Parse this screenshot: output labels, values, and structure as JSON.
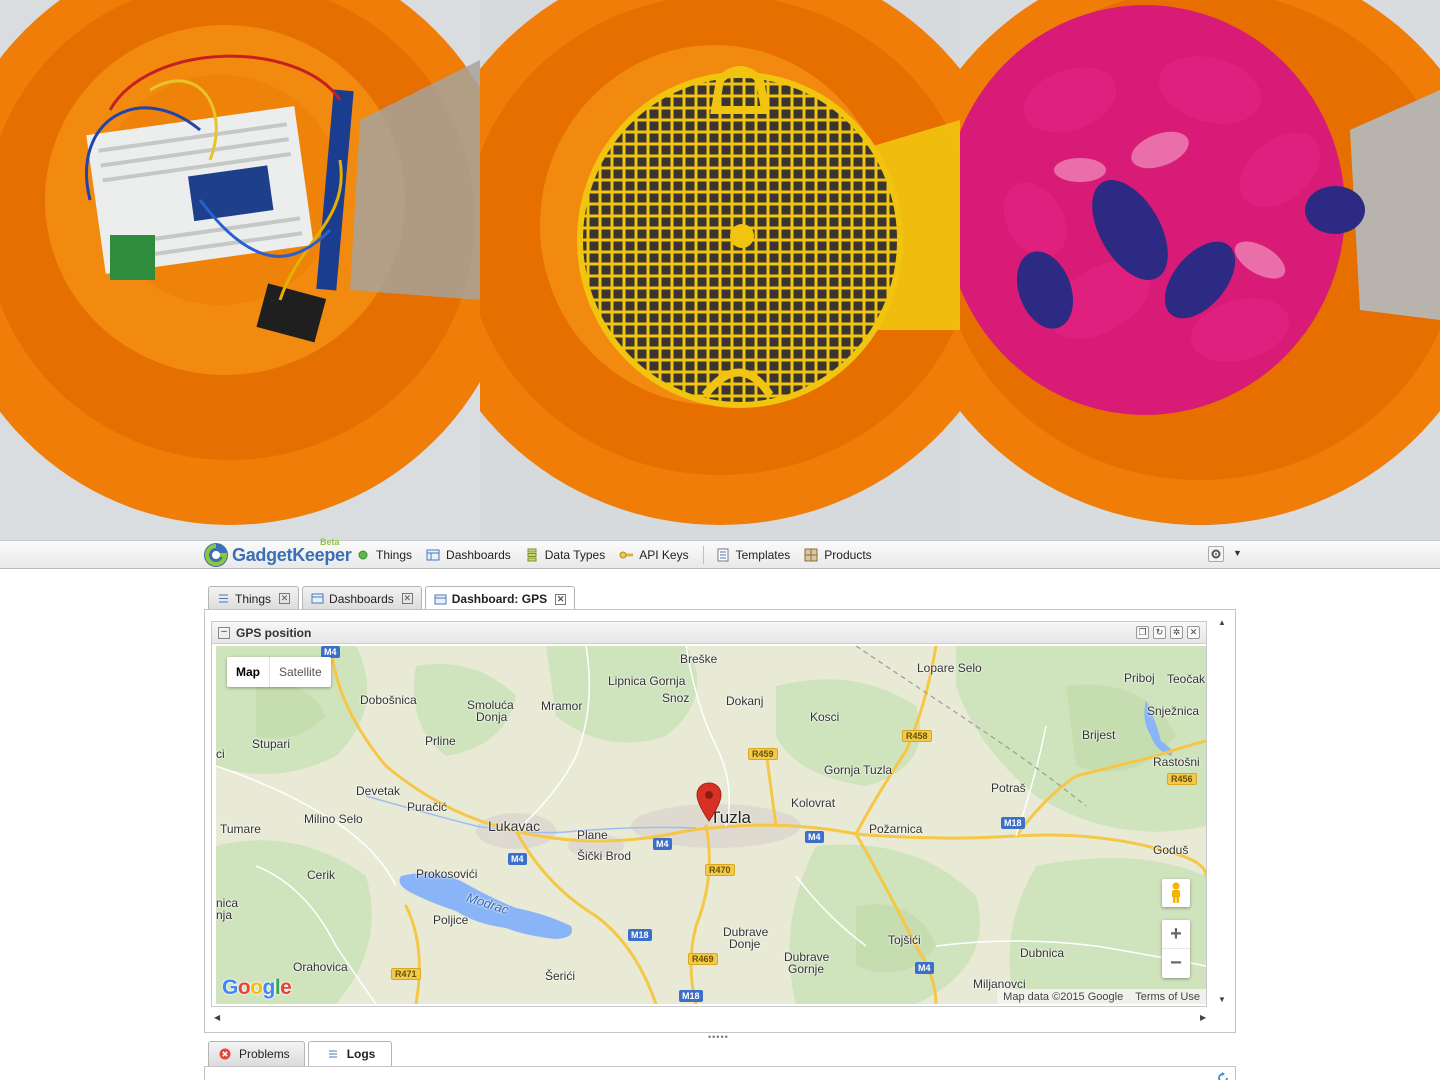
{
  "app": {
    "logo_text": "GadgetKeeper",
    "logo_badge": "Beta"
  },
  "nav": {
    "items": [
      {
        "label": "Things",
        "icon": "things-dot-icon"
      },
      {
        "label": "Dashboards",
        "icon": "dashboards-icon"
      },
      {
        "label": "Data Types",
        "icon": "data-types-icon"
      },
      {
        "label": "API Keys",
        "icon": "key-icon"
      },
      {
        "label": "Templates",
        "icon": "templates-icon"
      },
      {
        "label": "Products",
        "icon": "products-icon"
      }
    ]
  },
  "tabs": [
    {
      "label": "Things",
      "active": false
    },
    {
      "label": "Dashboards",
      "active": false
    },
    {
      "label": "Dashboard: GPS",
      "active": true
    }
  ],
  "widget": {
    "title": "GPS position"
  },
  "map": {
    "map_type_options": [
      "Map",
      "Satellite"
    ],
    "selected_map_type": "Map",
    "zoom_in": "+",
    "zoom_out": "−",
    "attribution": "Map data ©2015 Google",
    "terms": "Terms of Use",
    "google_logo": "Google",
    "places": {
      "breske": "Breške",
      "lipnica": "Lipnica Gornja",
      "snoz": "Snoz",
      "dokanj": "Dokanj",
      "lopare": "Lopare Selo",
      "priboj": "Priboj",
      "teocak": "Teočak",
      "dobosnica": "Dobošnica",
      "smoluca": "Smoluća",
      "donja": "Donja",
      "mramor": "Mramor",
      "kosci": "Kosci",
      "snjeznica": "Snježnica",
      "brijest": "Brijest",
      "stupari": "Stupari",
      "prline": "Prline",
      "gornja_tuzla": "Gornja Tuzla",
      "rastosnica": "Rastošni",
      "devetak": "Devetak",
      "kolovrat": "Kolovrat",
      "potras": "Potraš",
      "puracic": "Puračić",
      "milino": "Milino Selo",
      "tumare": "Tumare",
      "lukavac": "Lukavac",
      "plane": "Plane",
      "tuzla": "Tuzla",
      "pozarnica": "Požarnica",
      "sicki_brod": "Šički Brod",
      "godus": "Goduš",
      "cerik": "Cerik",
      "prokosovici": "Prokosovići",
      "modrac": "Modrac",
      "poljice": "Poljice",
      "dubrave_donje_1": "Dubrave",
      "dubrave_donje_2": "Donje",
      "tojsici": "Tojšići",
      "dubrave_gornje_1": "Dubrave",
      "dubrave_gornje_2": "Gornje",
      "dubnica": "Dubnica",
      "orahovica": "Orahovica",
      "serici": "Šerići",
      "miljanovci": "Miljanovci",
      "left_ci": "ci",
      "left_nica": "nica",
      "left_nja": "nja"
    },
    "shields": {
      "m4_top": "M4",
      "r459": "R459",
      "r458": "R458",
      "r456": "R456",
      "m18_right": "M18",
      "m4_mid": "M4",
      "m4_left": "M4",
      "m4_lukavac": "M4",
      "r470": "R470",
      "m18_low": "M18",
      "r469": "R469",
      "m4_bottom": "M4",
      "r471": "R471",
      "m18_bottom": "M18"
    }
  },
  "bottom_tabs": [
    {
      "label": "Problems",
      "active": false
    },
    {
      "label": "Logs",
      "active": true
    }
  ],
  "colors": {
    "brand_blue": "#3b6fb6",
    "brand_green": "#8cc63f",
    "marker_red": "#d93025",
    "road_yellow": "#f6c746",
    "water_blue": "#8ab4f8"
  }
}
